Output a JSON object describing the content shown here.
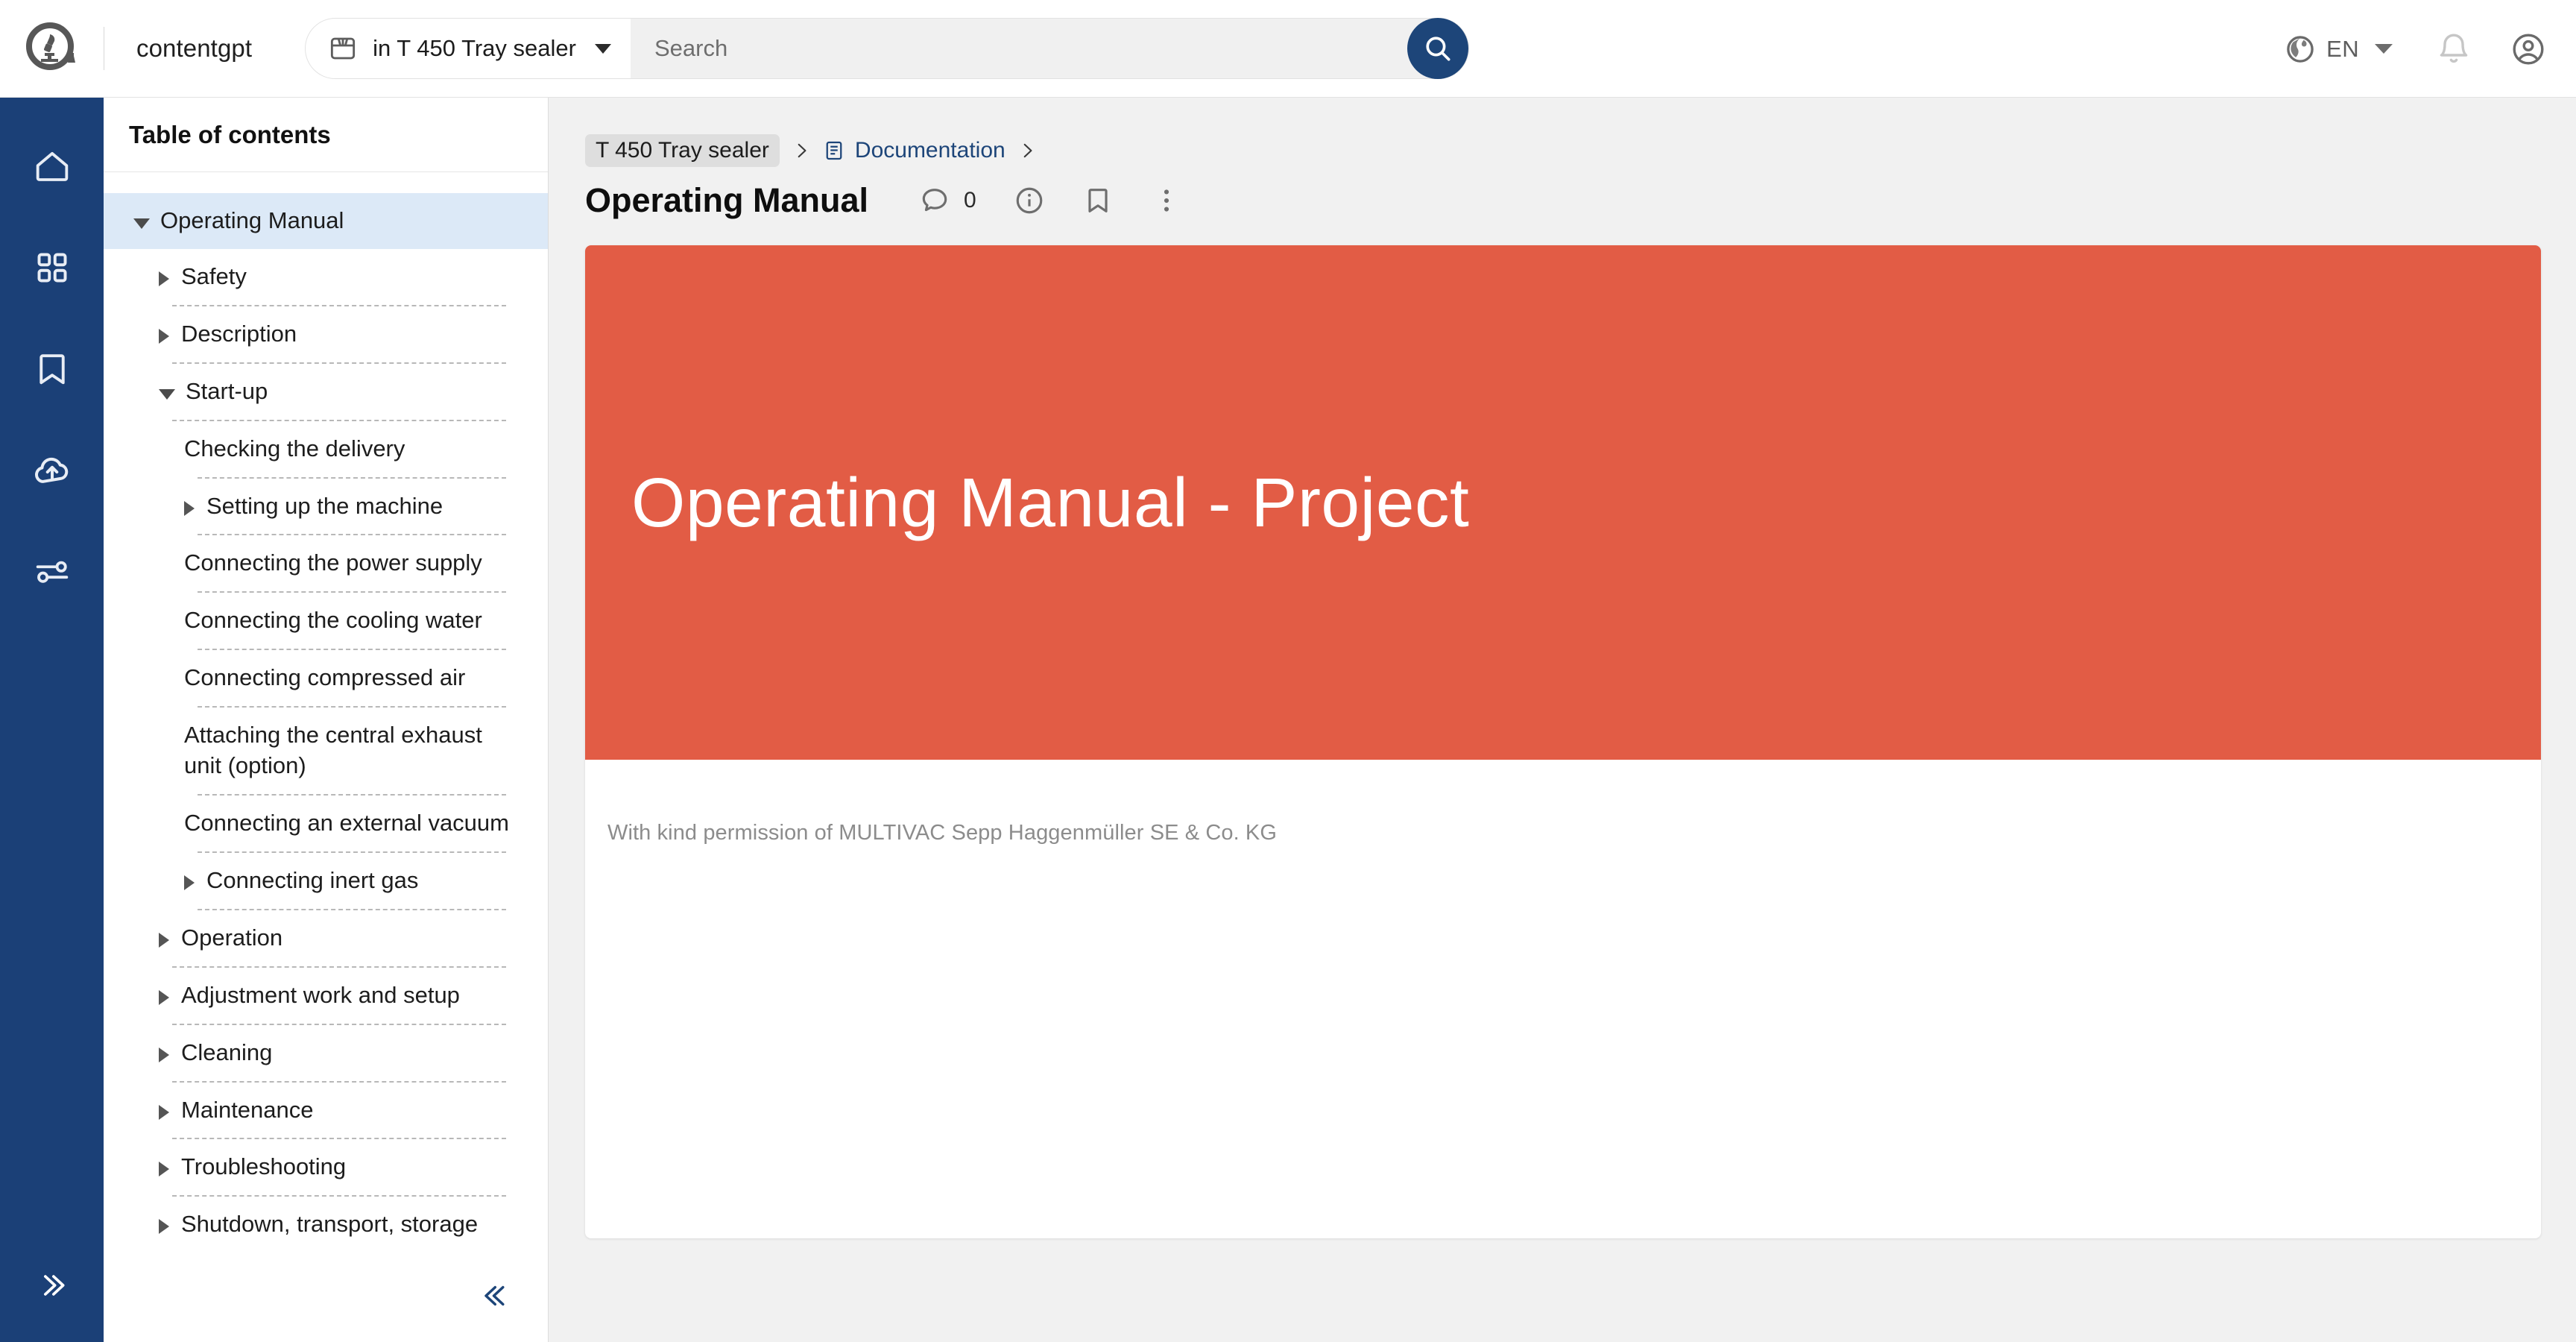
{
  "header": {
    "logo_icon": "microscope-flask-logo",
    "brand": "contentgpt",
    "scope": {
      "icon": "package-box-icon",
      "label": "in T 450 Tray sealer",
      "caret_icon": "chevron-down-icon"
    },
    "search": {
      "placeholder": "Search",
      "value": "",
      "button_icon": "search-icon"
    },
    "language": {
      "icon": "globe-icon",
      "code": "EN",
      "caret_icon": "chevron-down-icon"
    },
    "notifications_icon": "bell-icon",
    "account_icon": "account-circle-icon"
  },
  "rail": {
    "items": [
      {
        "name": "home",
        "icon": "home-icon"
      },
      {
        "name": "apps",
        "icon": "grid-apps-icon"
      },
      {
        "name": "bookmarks",
        "icon": "bookmark-icon"
      },
      {
        "name": "upload",
        "icon": "cloud-upload-icon"
      },
      {
        "name": "settings",
        "icon": "sliders-icon"
      }
    ],
    "expand_icon": "chevrons-right-icon"
  },
  "toc": {
    "title": "Table of contents",
    "collapse_icon": "chevrons-left-icon",
    "items": [
      {
        "label": "Operating Manual",
        "indent": 0,
        "marker": "down",
        "selected": true,
        "sep_after": false
      },
      {
        "label": "Safety",
        "indent": 1,
        "marker": "right",
        "selected": false,
        "sep_after": true
      },
      {
        "label": "Description",
        "indent": 1,
        "marker": "right",
        "selected": false,
        "sep_after": true
      },
      {
        "label": "Start-up",
        "indent": 1,
        "marker": "down",
        "selected": false,
        "sep_after": true
      },
      {
        "label": "Checking the delivery",
        "indent": 2,
        "marker": "none",
        "selected": false,
        "sep_after": true
      },
      {
        "label": "Setting up the machine",
        "indent": 2,
        "marker": "right",
        "selected": false,
        "sep_after": true
      },
      {
        "label": "Connecting the power supply",
        "indent": 2,
        "marker": "none",
        "selected": false,
        "sep_after": true
      },
      {
        "label": "Connecting the cooling water",
        "indent": 2,
        "marker": "none",
        "selected": false,
        "sep_after": true
      },
      {
        "label": "Connecting compressed air",
        "indent": 2,
        "marker": "none",
        "selected": false,
        "sep_after": true
      },
      {
        "label": "Attaching the central exhaust unit (option)",
        "indent": 2,
        "marker": "none",
        "selected": false,
        "sep_after": true
      },
      {
        "label": "Connecting an external vacuum",
        "indent": 2,
        "marker": "none",
        "selected": false,
        "sep_after": true
      },
      {
        "label": "Connecting inert gas",
        "indent": 2,
        "marker": "right",
        "selected": false,
        "sep_after": true
      },
      {
        "label": "Operation",
        "indent": 1,
        "marker": "right",
        "selected": false,
        "sep_after": true
      },
      {
        "label": "Adjustment work and setup",
        "indent": 1,
        "marker": "right",
        "selected": false,
        "sep_after": true
      },
      {
        "label": "Cleaning",
        "indent": 1,
        "marker": "right",
        "selected": false,
        "sep_after": true
      },
      {
        "label": "Maintenance",
        "indent": 1,
        "marker": "right",
        "selected": false,
        "sep_after": true
      },
      {
        "label": "Troubleshooting",
        "indent": 1,
        "marker": "right",
        "selected": false,
        "sep_after": true
      },
      {
        "label": "Shutdown, transport, storage",
        "indent": 1,
        "marker": "right",
        "selected": false,
        "sep_after": false
      }
    ]
  },
  "main": {
    "breadcrumb": {
      "chip": "T 450 Tray sealer",
      "sep1_icon": "chevron-right-icon",
      "link_icon": "document-icon",
      "link": "Documentation",
      "sep2_icon": "chevron-right-icon"
    },
    "title": "Operating Manual",
    "actions": {
      "comment_icon": "comment-bubble-icon",
      "comment_count": "0",
      "info_icon": "info-circle-icon",
      "bookmark_icon": "bookmark-icon",
      "more_icon": "kebab-menu-icon"
    },
    "document": {
      "banner_title": "Operating Manual - Project",
      "banner_color": "#e25c45",
      "credit": "With kind permission of MULTIVAC Sepp Haggenmüller SE & Co. KG"
    }
  },
  "colors": {
    "rail_blue": "#1b4077",
    "accent_blue": "#1d4579",
    "selected_row": "#dce9f7",
    "banner_red": "#e25c45"
  }
}
